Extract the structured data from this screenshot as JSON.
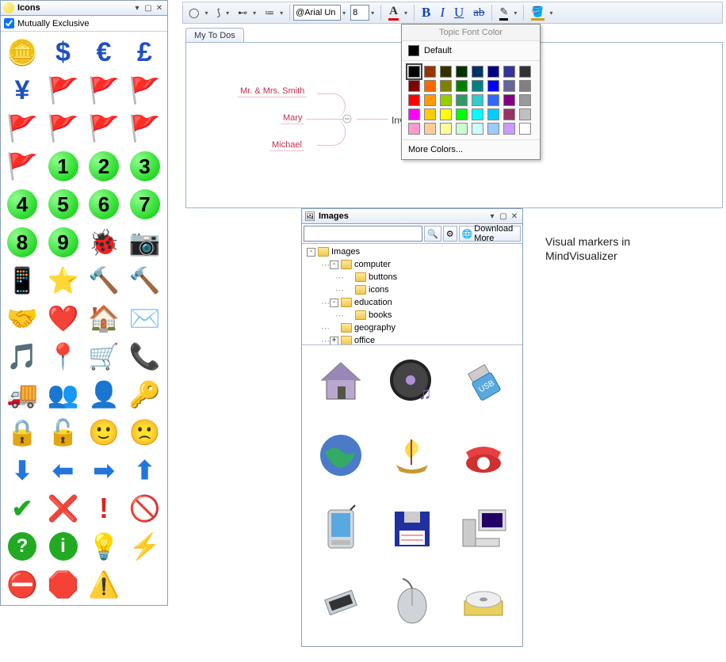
{
  "icons_panel": {
    "title": "Icons",
    "mutex_label": "Mutually Exclusive",
    "mutex_checked": true,
    "icons": [
      "coins",
      "dollar",
      "euro",
      "pound",
      "yen",
      "flag-black",
      "flag-blue",
      "flag-green",
      "flag-orange",
      "flag-purple",
      "flag-red",
      "flag-white",
      "flag-yellow",
      "num-1",
      "num-2",
      "num-3",
      "num-4",
      "num-5",
      "num-6",
      "num-7",
      "num-8",
      "num-9",
      "ladybug",
      "camera",
      "mobile",
      "star",
      "gavel",
      "hammer",
      "handshake",
      "heart",
      "house",
      "envelope",
      "music-note",
      "pushpin",
      "shopping-cart",
      "telephone",
      "truck",
      "people",
      "person",
      "key",
      "lock-closed",
      "lock-open",
      "smiley-happy",
      "smiley-sad",
      "arrow-down",
      "arrow-left",
      "arrow-right",
      "arrow-up",
      "check",
      "cancel-x",
      "exclaim",
      "no-entry",
      "question",
      "info",
      "lightbulb",
      "lightning",
      "no-entry-red",
      "stop",
      "warning"
    ]
  },
  "toolbar": {
    "font_name": "@Arial Un",
    "font_size": "8"
  },
  "tab": {
    "label": "My To Dos"
  },
  "mindmap": {
    "nodes": [
      "Mr. & Mrs. Smith",
      "Mary",
      "Michael"
    ],
    "root": "Invite"
  },
  "color_popup": {
    "title": "Topic Font Color",
    "default_label": "Default",
    "more_label": "More Colors...",
    "selected_index": 0,
    "swatches": [
      "#000000",
      "#993300",
      "#333300",
      "#003300",
      "#003366",
      "#000080",
      "#333399",
      "#333333",
      "#800000",
      "#ff6600",
      "#808000",
      "#008000",
      "#008080",
      "#0000ff",
      "#666699",
      "#808080",
      "#ff0000",
      "#ff9900",
      "#99cc00",
      "#339966",
      "#33cccc",
      "#3366ff",
      "#800080",
      "#999999",
      "#ff00ff",
      "#ffcc00",
      "#ffff00",
      "#00ff00",
      "#00ffff",
      "#00ccff",
      "#993366",
      "#c0c0c0",
      "#ff99cc",
      "#ffcc99",
      "#ffff99",
      "#ccffcc",
      "#ccffff",
      "#99ccff",
      "#cc99ff",
      "#ffffff"
    ]
  },
  "images_panel": {
    "title": "Images",
    "search_placeholder": "",
    "download_label": "Download More",
    "tree": [
      {
        "level": 0,
        "expand": "-",
        "label": "Images"
      },
      {
        "level": 1,
        "expand": "-",
        "label": "computer"
      },
      {
        "level": 2,
        "expand": "",
        "label": "buttons"
      },
      {
        "level": 2,
        "expand": "",
        "label": "icons"
      },
      {
        "level": 1,
        "expand": "-",
        "label": "education"
      },
      {
        "level": 2,
        "expand": "",
        "label": "books"
      },
      {
        "level": 1,
        "expand": "",
        "label": "geography"
      },
      {
        "level": 1,
        "expand": "+",
        "label": "office"
      }
    ],
    "gallery": [
      "house",
      "cd-music",
      "usb",
      "globe",
      "ship",
      "telephone",
      "pda",
      "floppy",
      "computer",
      "chip",
      "mouse",
      "cdrom"
    ]
  },
  "caption": {
    "line1": "Visual markers in",
    "line2": "MindVisualizer"
  }
}
